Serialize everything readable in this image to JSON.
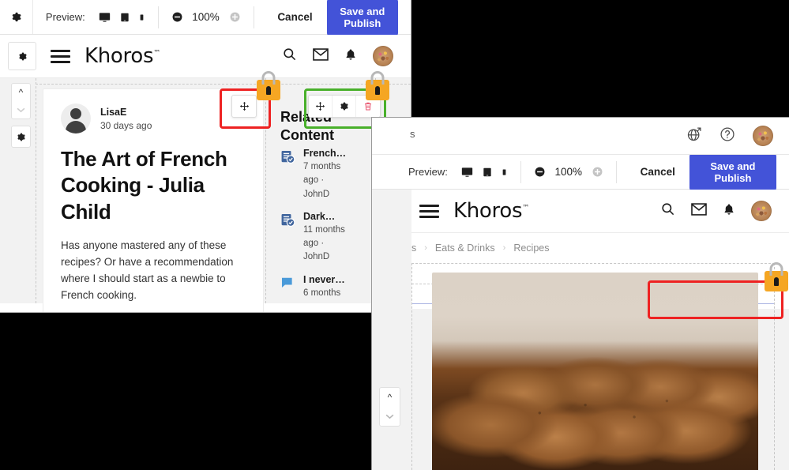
{
  "editor_panel_1": {
    "toolbar": {
      "gear_icon": "gear-icon",
      "preview_label": "Preview:",
      "devices": [
        "desktop-icon",
        "tablet-icon",
        "mobile-icon"
      ],
      "zoom_out_icon": "zoom-out-icon",
      "zoom_level": "100%",
      "zoom_in_icon": "zoom-in-icon",
      "cancel_label": "Cancel",
      "publish_label": "Save and Publish"
    },
    "site_header": {
      "gear_icon": "gear-icon",
      "menu_icon": "hamburger-menu-icon",
      "brand": "Khoros",
      "brand_tm": "™",
      "icons": [
        "search-icon",
        "envelope-icon",
        "bell-icon",
        "avatar"
      ]
    },
    "rail": {
      "move_up_icon": "chevron-up-icon",
      "move_down_icon": "chevron-down-icon",
      "settings_icon": "gear-icon"
    },
    "article": {
      "author": "LisaE",
      "posted": "30 days ago",
      "title": "The Art of French Cooking - Julia Child",
      "body": "Has anyone mastered any of these recipes? Or have a recommendation where I should start as a newbie to French cooking."
    },
    "related_content": {
      "title": "Related Content",
      "items": [
        {
          "icon": "article-verified-icon",
          "name": "French…",
          "meta": "7 months ago · JohnD"
        },
        {
          "icon": "article-verified-icon",
          "name": "Dark…",
          "meta": "11 months ago · JohnD"
        },
        {
          "icon": "comment-bubble-icon",
          "name": "I never…",
          "meta": "6 months"
        }
      ]
    },
    "widget_toolbars": {
      "red_selection": {
        "move_icon": "move-handle-icon",
        "lock_icon": "lock-icon"
      },
      "green_selection": {
        "move_icon": "move-handle-icon",
        "settings_icon": "gear-icon",
        "delete_icon": "trash-icon",
        "lock_icon": "lock-icon"
      }
    }
  },
  "editor_panel_2": {
    "topbar": {
      "left_fragment": "s",
      "globe_icon": "globe-external-link-icon",
      "help_icon": "help-circle-icon",
      "avatar": "avatar"
    },
    "toolbar": {
      "preview_label": "Preview:",
      "devices": [
        "desktop-icon",
        "tablet-icon",
        "mobile-icon"
      ],
      "zoom_out_icon": "zoom-out-icon",
      "zoom_level": "100%",
      "zoom_in_icon": "zoom-in-icon",
      "cancel_label": "Cancel",
      "publish_label": "Save and Publish"
    },
    "site_header": {
      "menu_icon": "hamburger-menu-icon",
      "brand": "Khoros",
      "brand_tm": "™",
      "icons": [
        "search-icon",
        "envelope-icon",
        "bell-icon",
        "avatar"
      ]
    },
    "breadcrumb": {
      "cut_item": "s",
      "items": [
        "Eats & Drinks",
        "Recipes"
      ],
      "separator": "›"
    },
    "rail": {
      "move_up_icon": "chevron-up-icon",
      "move_down_icon": "chevron-down-icon"
    },
    "selection": {
      "lock_icon": "lock-icon"
    },
    "image": {
      "alt": "chocolate-cake-with-frosting-swirls"
    }
  },
  "colors": {
    "accent": "#4353d8",
    "selection_red": "#ee2222",
    "selection_green": "#49b02b",
    "lock_orange": "#f5a623"
  }
}
